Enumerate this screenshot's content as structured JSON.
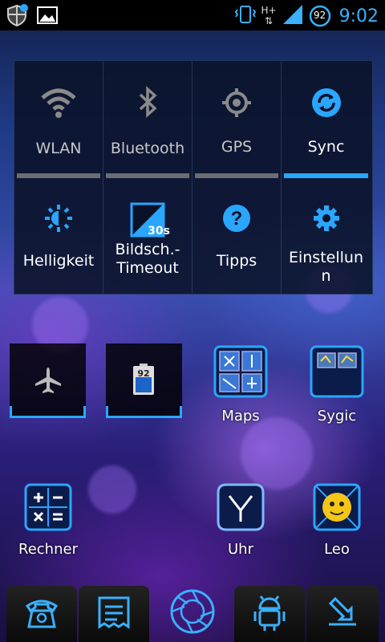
{
  "status_bar": {
    "time": "9:02",
    "network_type": "H+",
    "battery_level": "92",
    "icons": [
      "shield-notification-icon",
      "gallery-notification-icon",
      "vibrate-icon",
      "network-icon",
      "signal-icon",
      "battery-icon"
    ]
  },
  "quick_settings": {
    "toggles": [
      {
        "label": "WLAN",
        "icon": "wifi-icon",
        "active": false
      },
      {
        "label": "Bluetooth",
        "icon": "bluetooth-icon",
        "active": false
      },
      {
        "label": "GPS",
        "icon": "gps-icon",
        "active": false
      },
      {
        "label": "Sync",
        "icon": "sync-icon",
        "active": true
      }
    ],
    "actions": [
      {
        "label": "Helligkeit",
        "icon": "brightness-icon"
      },
      {
        "label_line1": "Bildsch.-",
        "label_line2": "Timeout",
        "icon": "screen-timeout-icon",
        "badge": "30s"
      },
      {
        "label": "Tipps",
        "icon": "help-icon"
      },
      {
        "label_line1": "Einstellun",
        "label_line2": "n",
        "icon": "settings-icon"
      }
    ]
  },
  "home": {
    "widgets": [
      {
        "icon": "airplane-mode-icon"
      },
      {
        "icon": "battery-widget-icon",
        "value": "92"
      }
    ],
    "apps": [
      {
        "label": "Maps"
      },
      {
        "label": "Sygic"
      },
      {
        "label": "Rechner"
      },
      {
        "label": "Uhr"
      },
      {
        "label": "Leo"
      }
    ]
  },
  "dock": {
    "items": [
      "phone-icon",
      "messages-icon",
      "app-drawer-icon",
      "android-icon",
      "download-icon"
    ]
  },
  "colors": {
    "accent": "#2aa6ff",
    "indicator_off": "#6a6e74"
  }
}
